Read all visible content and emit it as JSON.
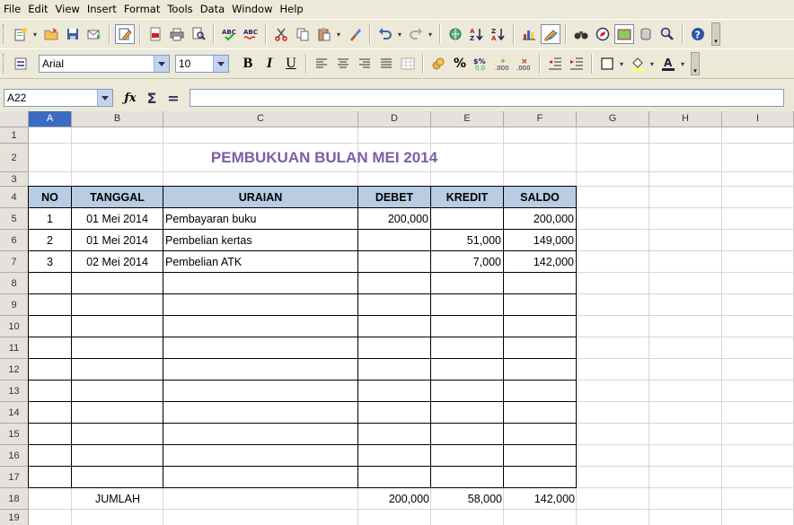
{
  "menu": [
    "File",
    "Edit",
    "View",
    "Insert",
    "Format",
    "Tools",
    "Data",
    "Window",
    "Help"
  ],
  "formatting": {
    "font_name": "Arial",
    "font_size": "10"
  },
  "formula_bar": {
    "cell_ref": "A22",
    "content": ""
  },
  "sheet": {
    "columns": [
      "A",
      "B",
      "C",
      "D",
      "E",
      "F",
      "G",
      "H",
      "I"
    ],
    "selected_column": "A",
    "rows": [
      "1",
      "2",
      "3",
      "4",
      "5",
      "6",
      "7",
      "8",
      "9",
      "10",
      "11",
      "12",
      "13",
      "14",
      "15",
      "16",
      "17",
      "18",
      "19"
    ],
    "title": "PEMBUKUAN BULAN  MEI 2014",
    "headers": [
      "NO",
      "TANGGAL",
      "URAIAN",
      "DEBET",
      "KREDIT",
      "SALDO"
    ],
    "entries": [
      {
        "no": "1",
        "tanggal": "01 Mei 2014",
        "uraian": "Pembayaran buku",
        "debet": "200,000",
        "kredit": "",
        "saldo": "200,000"
      },
      {
        "no": "2",
        "tanggal": "01 Mei 2014",
        "uraian": "Pembelian kertas",
        "debet": "",
        "kredit": "51,000",
        "saldo": "149,000"
      },
      {
        "no": "3",
        "tanggal": "02 Mei 2014",
        "uraian": "Pembelian ATK",
        "debet": "",
        "kredit": "7,000",
        "saldo": "142,000"
      }
    ],
    "total": {
      "label": "JUMLAH",
      "debet": "200,000",
      "kredit": "58,000",
      "saldo": "142,000"
    }
  },
  "colors": {
    "header_fill": "#b8cce4",
    "title_color": "#7b5ea7",
    "selected_header": "#3b6cc2"
  }
}
